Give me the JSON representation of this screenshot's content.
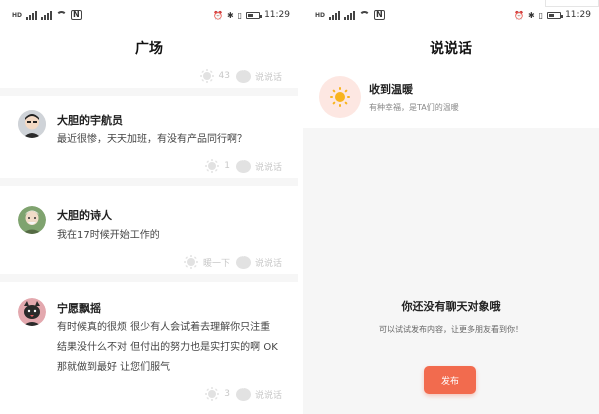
{
  "status_left": {
    "time": "11:29",
    "tiny_label": "HD"
  },
  "status_right": {
    "time": "11:29",
    "tiny_label": "HD"
  },
  "left_screen": {
    "title": "广场",
    "top_partial": {
      "warm_count": "43",
      "comment_label": "说说话"
    },
    "posts": [
      {
        "username": "大胆的宇航员",
        "text": "最近很惨，天天加班，有没有产品同行啊？",
        "warm_count": "1",
        "comment_label": "说说话"
      },
      {
        "username": "大胆的诗人",
        "text": "我在17时候开始工作的",
        "warm_count": "暖一下",
        "comment_label": "说说话"
      },
      {
        "username": "宁愿飘摇",
        "text": "有时候真的很烦 很少有人会试着去理解你只注重结果没什么不对 但付出的努力也是实打实的啊 OK 那就做到最好 让您们服气",
        "warm_count": "3",
        "comment_label": "说说话"
      }
    ]
  },
  "right_screen": {
    "title": "说说话",
    "warm_card": {
      "title": "收到温暖",
      "subtitle": "有种幸福，是TA们的温暖"
    },
    "empty_state": {
      "title": "你还没有聊天对象哦",
      "subtitle": "可以试试发布内容，让更多朋友看到你！"
    },
    "publish_label": "发布"
  },
  "colors": {
    "accent": "#f26b4e",
    "sun": "#f8b41e",
    "warm_bg": "#fde7e2",
    "muted": "#c8c8c8"
  },
  "icons": [
    "signal-icon",
    "wifi-icon",
    "nfc-icon",
    "alarm-icon",
    "bluetooth-icon",
    "vibrate-icon",
    "battery-icon",
    "sun-icon",
    "chat-bubble-icon"
  ]
}
